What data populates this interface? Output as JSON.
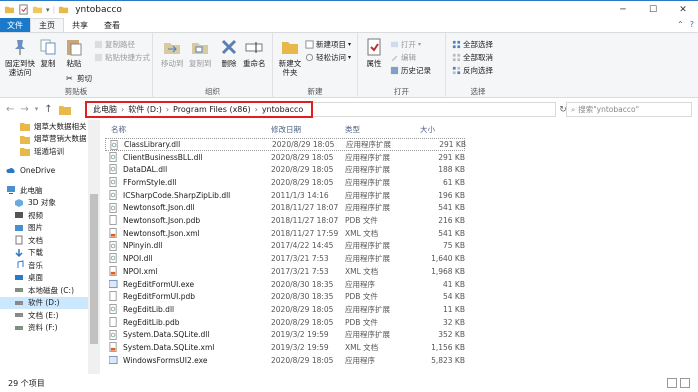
{
  "window": {
    "title": "yntobacco"
  },
  "tabs": [
    "文件",
    "主页",
    "共享",
    "查看"
  ],
  "ribbon": {
    "clipboard": {
      "pin": "固定到快速访问",
      "copy": "复制",
      "paste": "粘贴",
      "copy_path": "复制路径",
      "paste_shortcut": "粘贴快捷方式",
      "cut": "剪切",
      "label": "剪贴板"
    },
    "organize": {
      "move_to": "移动到",
      "copy_to": "复制到",
      "delete": "删除",
      "rename": "重命名",
      "label": "组织"
    },
    "new": {
      "new_folder": "新建文件夹",
      "new_item": "新建项目",
      "easy_access": "轻松访问",
      "label": "新建"
    },
    "open": {
      "properties": "属性",
      "open": "打开",
      "edit": "编辑",
      "history": "历史记录",
      "label": "打开"
    },
    "select": {
      "select_all": "全部选择",
      "select_none": "全部取消",
      "invert": "反向选择",
      "label": "选择"
    }
  },
  "address": {
    "crumbs": [
      "此电脑",
      "软件 (D:)",
      "Program Files (x86)",
      "yntobacco"
    ],
    "search_placeholder": "搜索\"yntobacco\""
  },
  "nav": [
    {
      "label": "烟草大数据相关",
      "icon": "folder-icon",
      "selected": false
    },
    {
      "label": "烟草营销大数据",
      "icon": "folder-icon",
      "selected": false
    },
    {
      "label": "瑶遁培训",
      "icon": "folder-icon",
      "selected": false
    },
    {
      "sep": true
    },
    {
      "label": "OneDrive",
      "icon": "cloud-icon",
      "selected": false
    },
    {
      "sep": true
    },
    {
      "label": "此电脑",
      "icon": "computer-icon",
      "selected": false
    },
    {
      "label": "3D 对象",
      "icon": "cube-icon",
      "selected": false
    },
    {
      "label": "视频",
      "icon": "video-icon",
      "selected": false
    },
    {
      "label": "图片",
      "icon": "picture-icon",
      "selected": false
    },
    {
      "label": "文档",
      "icon": "document-icon",
      "selected": false
    },
    {
      "label": "下载",
      "icon": "download-icon",
      "selected": false
    },
    {
      "label": "音乐",
      "icon": "music-icon",
      "selected": false
    },
    {
      "label": "桌面",
      "icon": "desktop-icon",
      "selected": false
    },
    {
      "label": "本地磁盘 (C:)",
      "icon": "drive-icon",
      "selected": false
    },
    {
      "label": "软件 (D:)",
      "icon": "drive-icon",
      "selected": true
    },
    {
      "label": "文档 (E:)",
      "icon": "drive-icon",
      "selected": false
    },
    {
      "label": "资料 (F:)",
      "icon": "drive-icon",
      "selected": false
    }
  ],
  "columns": {
    "name": "名称",
    "date": "修改日期",
    "type": "类型",
    "size": "大小"
  },
  "files": [
    {
      "name": "ClassLibrary.dll",
      "date": "2020/8/29 18:05",
      "type": "应用程序扩展",
      "size": "291 KB",
      "kind": "dll"
    },
    {
      "name": "ClientBusinessBLL.dll",
      "date": "2020/8/29 18:05",
      "type": "应用程序扩展",
      "size": "291 KB",
      "kind": "dll"
    },
    {
      "name": "DataDAL.dll",
      "date": "2020/8/29 18:05",
      "type": "应用程序扩展",
      "size": "188 KB",
      "kind": "dll"
    },
    {
      "name": "FFormStyle.dll",
      "date": "2020/8/29 18:05",
      "type": "应用程序扩展",
      "size": "61 KB",
      "kind": "dll"
    },
    {
      "name": "ICSharpCode.SharpZipLib.dll",
      "date": "2011/1/3 14:16",
      "type": "应用程序扩展",
      "size": "196 KB",
      "kind": "dll"
    },
    {
      "name": "Newtonsoft.Json.dll",
      "date": "2018/11/27 18:07",
      "type": "应用程序扩展",
      "size": "541 KB",
      "kind": "dll"
    },
    {
      "name": "Newtonsoft.Json.pdb",
      "date": "2018/11/27 18:07",
      "type": "PDB 文件",
      "size": "216 KB",
      "kind": "pdb"
    },
    {
      "name": "Newtonsoft.Json.xml",
      "date": "2018/11/27 17:59",
      "type": "XML 文档",
      "size": "541 KB",
      "kind": "xml"
    },
    {
      "name": "NPinyin.dll",
      "date": "2017/4/22 14:45",
      "type": "应用程序扩展",
      "size": "75 KB",
      "kind": "dll"
    },
    {
      "name": "NPOI.dll",
      "date": "2017/3/21 7:53",
      "type": "应用程序扩展",
      "size": "1,640 KB",
      "kind": "dll"
    },
    {
      "name": "NPOI.xml",
      "date": "2017/3/21 7:53",
      "type": "XML 文档",
      "size": "1,968 KB",
      "kind": "xml"
    },
    {
      "name": "RegEditFormUI.exe",
      "date": "2020/8/30 18:35",
      "type": "应用程序",
      "size": "41 KB",
      "kind": "exe"
    },
    {
      "name": "RegEditFormUI.pdb",
      "date": "2020/8/30 18:35",
      "type": "PDB 文件",
      "size": "54 KB",
      "kind": "pdb"
    },
    {
      "name": "RegEditLib.dll",
      "date": "2020/8/29 18:05",
      "type": "应用程序扩展",
      "size": "11 KB",
      "kind": "dll"
    },
    {
      "name": "RegEditLib.pdb",
      "date": "2020/8/29 18:05",
      "type": "PDB 文件",
      "size": "32 KB",
      "kind": "pdb"
    },
    {
      "name": "System.Data.SQLite.dll",
      "date": "2019/3/2 19:59",
      "type": "应用程序扩展",
      "size": "352 KB",
      "kind": "dll"
    },
    {
      "name": "System.Data.SQLite.xml",
      "date": "2019/3/2 19:59",
      "type": "XML 文档",
      "size": "1,156 KB",
      "kind": "xml"
    },
    {
      "name": "WindowsFormsUI2.exe",
      "date": "2020/8/29 18:05",
      "type": "应用程序",
      "size": "5,823 KB",
      "kind": "exe"
    }
  ],
  "status": {
    "count": "29 个项目"
  },
  "colors": {
    "accent": "#1979ca",
    "highlight": "#e02020",
    "selected": "#cce8ff",
    "folder": "#e8b84a"
  }
}
